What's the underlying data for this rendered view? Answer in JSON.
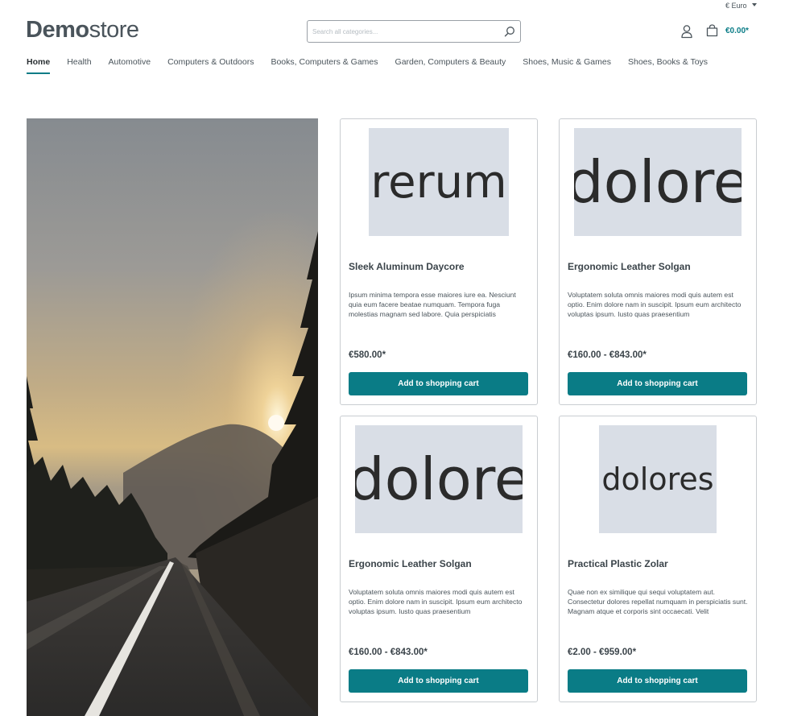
{
  "header": {
    "currency": "€ Euro",
    "logo_bold": "Demo",
    "logo_light": "store",
    "search_placeholder": "Search all categories...",
    "cart_total": "€0.00*"
  },
  "nav": {
    "items": [
      "Home",
      "Health",
      "Automotive",
      "Computers & Outdoors",
      "Books, Computers & Games",
      "Garden, Computers & Beauty",
      "Shoes, Music & Games",
      "Shoes, Books & Toys"
    ],
    "active": "Home"
  },
  "products": [
    {
      "image_text": "rerum",
      "name": "Sleek Aluminum Daycore",
      "description": "Ipsum minima tempora esse maiores iure ea. Nesciunt quia eum facere beatae numquam. Tempora fuga molestias magnam sed labore. Quia perspiciatis",
      "price": "€580.00*",
      "button": "Add to shopping cart"
    },
    {
      "image_text": "dolore",
      "name": "Ergonomic Leather Solgan",
      "description": "Voluptatem soluta omnis maiores modi quis autem est optio. Enim dolore nam in suscipit. Ipsum eum architecto voluptas ipsum. Iusto quas praesentium",
      "price": "€160.00 - €843.00*",
      "button": "Add to shopping cart"
    },
    {
      "image_text": "dolore",
      "name": "Ergonomic Leather Solgan",
      "description": "Voluptatem soluta omnis maiores modi quis autem est optio. Enim dolore nam in suscipit. Ipsum eum architecto voluptas ipsum. Iusto quas praesentium",
      "price": "€160.00 - €843.00*",
      "button": "Add to shopping cart"
    },
    {
      "image_text": "dolores",
      "name": "Practical Plastic Zolar",
      "description": "Quae non ex similique qui sequi voluptatem aut. Consectetur dolores repellat numquam in perspiciatis sunt. Magnam atque et corporis sint occaecati. Velit",
      "price": "€2.00 - €959.00*",
      "button": "Add to shopping cart"
    }
  ],
  "colors": {
    "accent": "#0a7c86",
    "text": "#4a545b",
    "placeholder_bg": "#d9dee6"
  }
}
